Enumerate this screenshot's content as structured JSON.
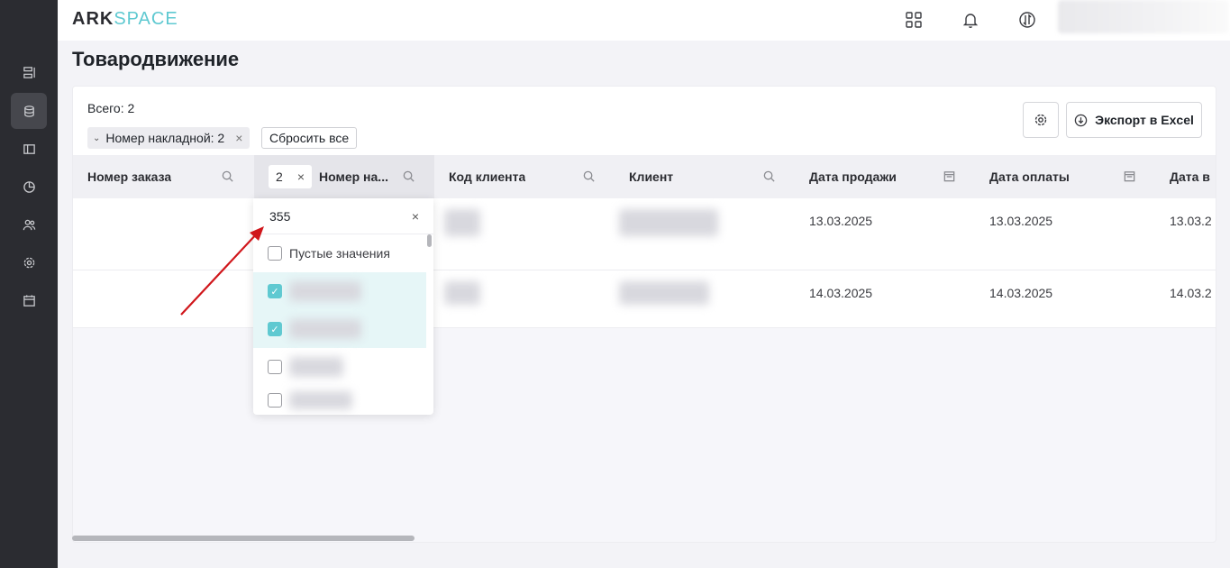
{
  "app": {
    "logo_main": "ARK",
    "logo_accent": "SPACE"
  },
  "page": {
    "title": "Товародвижение"
  },
  "summary": {
    "total": "Всего: 2"
  },
  "filters": {
    "chip_label": "Номер накладной: 2",
    "reset_label": "Сбросить все"
  },
  "actions": {
    "export_label": "Экспорт в Excel"
  },
  "columns": {
    "order": "Номер заказа",
    "invoice": "Номер на...",
    "invoice_count": "2",
    "client_code": "Код клиента",
    "client": "Клиент",
    "sale_date": "Дата продажи",
    "pay_date": "Дата оплаты",
    "other_date": "Дата в"
  },
  "rows": [
    {
      "sale_date": "13.03.2025",
      "pay_date": "13.03.2025",
      "other_date": "13.03.2"
    },
    {
      "sale_date": "14.03.2025",
      "pay_date": "14.03.2025",
      "other_date": "14.03.2"
    }
  ],
  "dropdown": {
    "search_value": "355",
    "empty_label": "Пустые значения",
    "items": [
      {
        "checked": true
      },
      {
        "checked": true
      },
      {
        "checked": false
      },
      {
        "checked": false
      }
    ]
  },
  "colors": {
    "accent": "#5fc9d1",
    "sidebar": "#2b2c31",
    "arrow": "#d0161b"
  }
}
